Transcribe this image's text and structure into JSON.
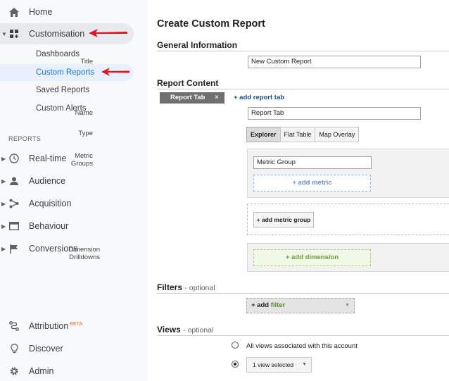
{
  "sidebar": {
    "home": "Home",
    "customisation": "Customisation",
    "sub_items": [
      "Dashboards",
      "Custom Reports",
      "Saved Reports",
      "Custom Alerts"
    ],
    "section_label": "REPORTS",
    "reports": [
      "Real-time",
      "Audience",
      "Acquisition",
      "Behaviour",
      "Conversions"
    ],
    "attribution": "Attribution",
    "attribution_badge": "BETA",
    "discover": "Discover",
    "admin": "Admin",
    "icons": [
      "home-icon",
      "customisation-icon",
      "clock-icon",
      "person-icon",
      "acquisition-icon",
      "behaviour-icon",
      "flag-icon",
      "attribution-icon",
      "lightbulb-icon",
      "gear-icon"
    ]
  },
  "main": {
    "title": "Create Custom Report",
    "general_info": "General Information",
    "title_label": "Title",
    "title_value": "New Custom Report",
    "report_content": "Report Content",
    "tab_name": "Report Tab",
    "tab_close": "×",
    "add_report_tab": "+ add report tab",
    "name_label": "Name",
    "name_value": "Report Tab",
    "type_label": "Type",
    "types": [
      "Explorer",
      "Flat Table",
      "Map Overlay"
    ],
    "metric_groups_label": "Metric Groups",
    "metric_group_value": "Metric Group",
    "add_metric": "+ add metric",
    "add_metric_group": "+ add metric group",
    "dimension_label": "Dimension Drilldowns",
    "add_dimension": "+ add dimension",
    "filters_title": "Filters",
    "filters_optional": "- optional",
    "filter_plus": "+ add",
    "filter_word": "filter",
    "views_title": "Views",
    "views_optional": "- optional",
    "view_all": "All views associated with this account",
    "view_selected": "1 view selected",
    "dropdown_caret": "▼"
  },
  "colors": {
    "accent": "#1a73e8",
    "arrow": "#e8141c",
    "sidebar_bg": "#f8f9fa"
  }
}
